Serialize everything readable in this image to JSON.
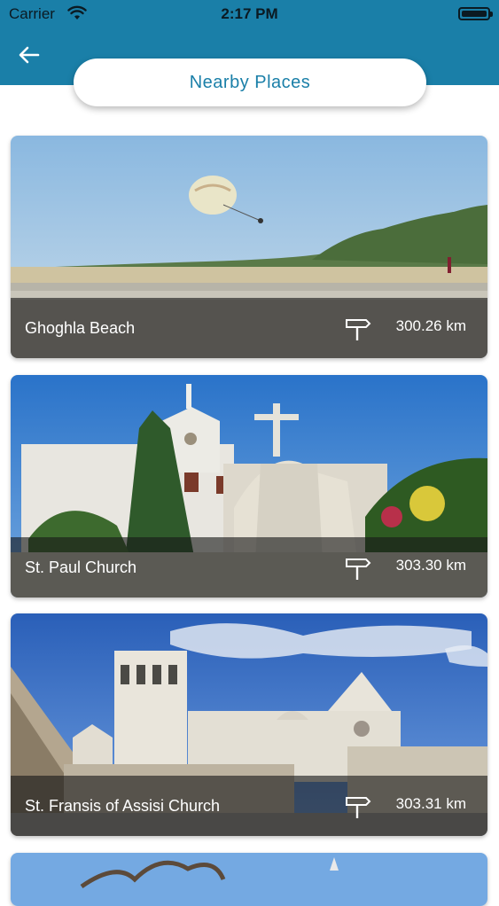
{
  "status_bar": {
    "carrier": "Carrier",
    "time": "2:17 PM"
  },
  "header": {
    "title": "Nearby Places",
    "back_icon": "back-arrow-icon",
    "color": "#1a7fa8"
  },
  "places": [
    {
      "name": "Ghoghla Beach",
      "distance": "300.26 km",
      "icon": "signpost-icon"
    },
    {
      "name": "St. Paul Church",
      "distance": "303.30 km",
      "icon": "signpost-icon"
    },
    {
      "name": "St. Fransis of Assisi Church",
      "distance": "303.31 km",
      "icon": "signpost-icon"
    }
  ]
}
